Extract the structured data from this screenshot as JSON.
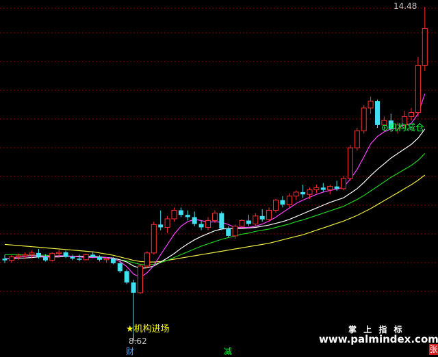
{
  "chart": {
    "high_label": "14.48",
    "low_label": "8.62",
    "buy_signal": "★机构进场",
    "sell_signal": "⊙机构减仓",
    "markers": {
      "cai": "财",
      "jian": "减",
      "zhang": "张"
    },
    "watermark": {
      "cn": "掌 上 指 标",
      "url": "www.palmindex.com"
    }
  },
  "colors": {
    "background": "#000000",
    "grid": "#8b0000",
    "up": "#ff3030",
    "down": "#40e0f0",
    "ma_fast": "#ff40ff",
    "ma_white": "#ffffff",
    "ma_green": "#20d020",
    "ma_yellow": "#f0f040"
  },
  "chart_data": {
    "type": "candlestick",
    "y_range": [
      8.62,
      14.48
    ],
    "candles": [
      [
        10.05,
        10.12,
        9.97,
        10.02
      ],
      [
        10.02,
        10.11,
        9.98,
        10.08
      ],
      [
        10.08,
        10.14,
        10.03,
        10.1
      ],
      [
        10.1,
        10.16,
        10.05,
        10.12
      ],
      [
        10.12,
        10.19,
        10.06,
        10.15
      ],
      [
        10.15,
        10.22,
        10.05,
        10.08
      ],
      [
        10.08,
        10.13,
        10.0,
        10.02
      ],
      [
        10.02,
        10.16,
        10.0,
        10.14
      ],
      [
        10.14,
        10.2,
        10.08,
        10.16
      ],
      [
        10.16,
        10.19,
        10.06,
        10.08
      ],
      [
        10.08,
        10.12,
        10.02,
        10.05
      ],
      [
        10.05,
        10.12,
        10.0,
        10.03
      ],
      [
        10.03,
        10.14,
        10.02,
        10.12
      ],
      [
        10.12,
        10.18,
        10.06,
        10.08
      ],
      [
        10.08,
        10.11,
        10.0,
        10.03
      ],
      [
        10.03,
        10.08,
        9.98,
        10.05
      ],
      [
        10.05,
        10.08,
        9.95,
        9.97
      ],
      [
        9.97,
        10.0,
        9.8,
        9.83
      ],
      [
        9.83,
        9.86,
        9.6,
        9.63
      ],
      [
        9.63,
        9.68,
        8.62,
        9.45
      ],
      [
        9.45,
        9.95,
        9.43,
        9.92
      ],
      [
        9.92,
        10.18,
        9.88,
        10.15
      ],
      [
        10.15,
        10.7,
        10.12,
        10.65
      ],
      [
        10.65,
        10.9,
        10.55,
        10.6
      ],
      [
        10.6,
        10.8,
        10.5,
        10.75
      ],
      [
        10.75,
        10.95,
        10.7,
        10.9
      ],
      [
        10.9,
        10.95,
        10.78,
        10.82
      ],
      [
        10.82,
        10.9,
        10.72,
        10.78
      ],
      [
        10.78,
        10.88,
        10.62,
        10.66
      ],
      [
        10.66,
        10.72,
        10.55,
        10.6
      ],
      [
        10.6,
        10.78,
        10.55,
        10.72
      ],
      [
        10.72,
        10.9,
        10.68,
        10.85
      ],
      [
        10.85,
        10.88,
        10.55,
        10.58
      ],
      [
        10.58,
        10.62,
        10.42,
        10.45
      ],
      [
        10.45,
        10.65,
        10.4,
        10.62
      ],
      [
        10.62,
        10.75,
        10.58,
        10.72
      ],
      [
        10.72,
        10.82,
        10.62,
        10.66
      ],
      [
        10.66,
        10.85,
        10.62,
        10.8
      ],
      [
        10.8,
        10.92,
        10.7,
        10.74
      ],
      [
        10.74,
        10.95,
        10.7,
        10.9
      ],
      [
        10.9,
        11.1,
        10.86,
        11.08
      ],
      [
        11.08,
        11.15,
        10.95,
        11.0
      ],
      [
        11.0,
        11.2,
        10.95,
        11.15
      ],
      [
        11.15,
        11.25,
        11.08,
        11.22
      ],
      [
        11.22,
        11.35,
        11.12,
        11.18
      ],
      [
        11.18,
        11.3,
        11.1,
        11.26
      ],
      [
        11.26,
        11.35,
        11.2,
        11.3
      ],
      [
        11.3,
        11.38,
        11.22,
        11.26
      ],
      [
        11.26,
        11.35,
        11.18,
        11.32
      ],
      [
        11.32,
        11.42,
        11.24,
        11.28
      ],
      [
        11.28,
        11.5,
        11.25,
        11.46
      ],
      [
        11.46,
        12.05,
        11.42,
        12.0
      ],
      [
        12.0,
        12.35,
        11.95,
        12.3
      ],
      [
        12.3,
        12.75,
        12.25,
        12.7
      ],
      [
        12.7,
        12.9,
        12.6,
        12.82
      ],
      [
        12.82,
        12.85,
        12.35,
        12.4
      ],
      [
        12.4,
        12.55,
        12.3,
        12.48
      ],
      [
        12.48,
        12.6,
        12.28,
        12.33
      ],
      [
        12.33,
        12.45,
        12.25,
        12.4
      ],
      [
        12.4,
        12.65,
        12.35,
        12.55
      ],
      [
        12.55,
        12.7,
        12.48,
        12.62
      ],
      [
        12.62,
        13.6,
        12.55,
        13.45
      ],
      [
        13.45,
        14.48,
        13.35,
        14.1
      ]
    ],
    "ma_fast": [
      10.04,
      10.06,
      10.08,
      10.09,
      10.1,
      10.1,
      10.09,
      10.09,
      10.1,
      10.1,
      10.09,
      10.08,
      10.07,
      10.07,
      10.07,
      10.07,
      10.05,
      10.0,
      9.91,
      9.78,
      9.72,
      9.8,
      9.93,
      10.12,
      10.3,
      10.48,
      10.62,
      10.7,
      10.74,
      10.72,
      10.69,
      10.7,
      10.69,
      10.65,
      10.6,
      10.6,
      10.6,
      10.62,
      10.66,
      10.71,
      10.78,
      10.86,
      10.94,
      11.02,
      11.08,
      11.13,
      11.18,
      11.22,
      11.25,
      11.27,
      11.31,
      11.45,
      11.62,
      11.84,
      12.07,
      12.2,
      12.28,
      12.33,
      12.36,
      12.4,
      12.43,
      12.6,
      12.95
    ],
    "ma_white": [
      10.05,
      10.05,
      10.06,
      10.06,
      10.07,
      10.08,
      10.08,
      10.08,
      10.08,
      10.09,
      10.09,
      10.09,
      10.09,
      10.09,
      10.08,
      10.07,
      10.06,
      10.03,
      9.99,
      9.92,
      9.88,
      9.89,
      9.92,
      9.99,
      10.06,
      10.14,
      10.23,
      10.31,
      10.38,
      10.44,
      10.49,
      10.54,
      10.57,
      10.58,
      10.58,
      10.58,
      10.59,
      10.6,
      10.62,
      10.64,
      10.67,
      10.7,
      10.74,
      10.79,
      10.84,
      10.89,
      10.94,
      10.99,
      11.04,
      11.08,
      11.12,
      11.2,
      11.28,
      11.39,
      11.51,
      11.62,
      11.72,
      11.82,
      11.9,
      11.98,
      12.06,
      12.17,
      12.33
    ],
    "ma_green": [
      10.12,
      10.12,
      10.12,
      10.11,
      10.11,
      10.11,
      10.11,
      10.1,
      10.1,
      10.1,
      10.09,
      10.09,
      10.08,
      10.08,
      10.07,
      10.06,
      10.05,
      10.03,
      10.01,
      9.98,
      9.95,
      9.94,
      9.95,
      9.98,
      10.02,
      10.07,
      10.12,
      10.17,
      10.22,
      10.27,
      10.31,
      10.35,
      10.39,
      10.42,
      10.45,
      10.48,
      10.5,
      10.53,
      10.55,
      10.57,
      10.6,
      10.63,
      10.66,
      10.7,
      10.73,
      10.77,
      10.81,
      10.85,
      10.89,
      10.93,
      10.97,
      11.03,
      11.09,
      11.16,
      11.24,
      11.32,
      11.4,
      11.48,
      11.55,
      11.62,
      11.69,
      11.78,
      11.9
    ],
    "ma_yellow": [
      10.3,
      10.29,
      10.28,
      10.27,
      10.26,
      10.25,
      10.24,
      10.23,
      10.22,
      10.21,
      10.2,
      10.19,
      10.18,
      10.17,
      10.15,
      10.13,
      10.11,
      10.08,
      10.05,
      10.02,
      10.0,
      9.99,
      9.99,
      10.0,
      10.02,
      10.04,
      10.06,
      10.08,
      10.1,
      10.12,
      10.14,
      10.16,
      10.18,
      10.2,
      10.22,
      10.24,
      10.26,
      10.28,
      10.3,
      10.32,
      10.35,
      10.38,
      10.41,
      10.44,
      10.47,
      10.51,
      10.55,
      10.59,
      10.63,
      10.67,
      10.71,
      10.76,
      10.81,
      10.87,
      10.93,
      11.0,
      11.07,
      11.14,
      11.21,
      11.28,
      11.35,
      11.43,
      11.52
    ]
  }
}
